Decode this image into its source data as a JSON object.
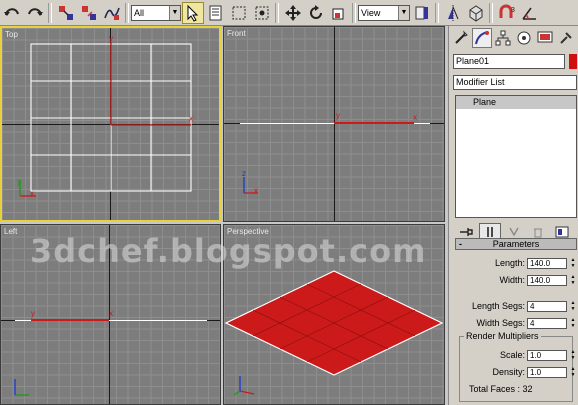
{
  "toolbar": {
    "selection_filter": "All",
    "coord_system": "View",
    "icons": [
      "undo-icon",
      "redo-icon",
      "link-icon",
      "unlink-icon",
      "bind-spacewarp-icon",
      "select-object-icon",
      "select-by-name-icon",
      "rect-region-icon",
      "window-crossing-icon",
      "move-icon",
      "rotate-icon",
      "scale-icon",
      "pivot-icon",
      "mirror-icon",
      "align-icon",
      "snap-icon",
      "angle-snap-icon"
    ]
  },
  "viewports": {
    "top": {
      "label": "Top"
    },
    "front": {
      "label": "Front"
    },
    "left": {
      "label": "Left"
    },
    "perspective": {
      "label": "Perspective"
    },
    "watermark": "3dchef.blogspot.com",
    "plane_color": "#cc1a1a",
    "active_border": "#e8d23c"
  },
  "axis_letters": {
    "x": "x",
    "y": "y",
    "z": "z"
  },
  "panel": {
    "object_name": "Plane01",
    "object_color": "#d01010",
    "modifier_list": "Modifier List",
    "stack_item": "Plane",
    "rollup_title": "Parameters",
    "length_label": "Length:",
    "length_value": "140.0",
    "width_label": "Width:",
    "width_value": "140.0",
    "length_segs_label": "Length Segs:",
    "length_segs_value": "4",
    "width_segs_label": "Width Segs:",
    "width_segs_value": "4",
    "render_multipliers": "Render Multipliers",
    "scale_label": "Scale:",
    "scale_value": "1.0",
    "density_label": "Density:",
    "density_value": "1.0",
    "total_faces": "Total Faces : 32"
  }
}
